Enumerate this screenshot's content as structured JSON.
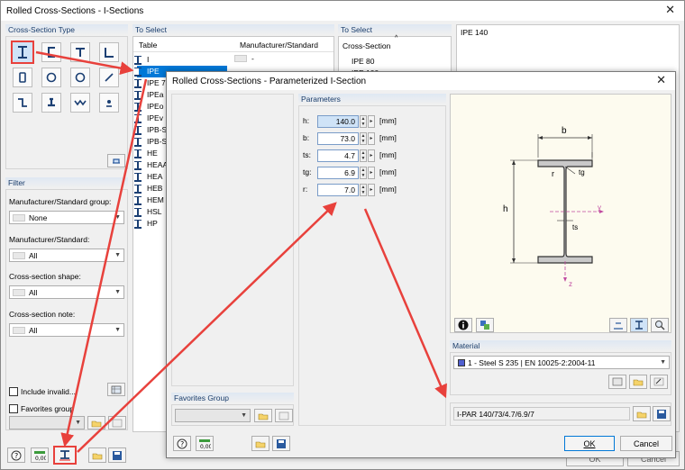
{
  "main_window": {
    "title": "Rolled Cross-Sections - I-Sections",
    "close_symbol": "✕",
    "cross_section_type_label": "Cross-Section Type",
    "filter_label": "Filter",
    "manufacturer_group_label": "Manufacturer/Standard group:",
    "manufacturer_group_value": "None",
    "manufacturer_label": "Manufacturer/Standard:",
    "manufacturer_value": "All",
    "shape_label": "Cross-section shape:",
    "shape_value": "All",
    "note_label": "Cross-section note:",
    "note_value": "All",
    "include_invalid_label": "Include invalid...",
    "favorites_label": "Favorites group",
    "to_select_left_label": "To Select",
    "to_select_right_label": "To Select",
    "table_col_header": "Table",
    "manufacturer_col_header": "Manufacturer/Standard",
    "tables": [
      "I",
      "IPE",
      "IPE 7",
      "IPEa",
      "IPEo",
      "IPEv",
      "IPB-S",
      "IPB-S",
      "HE",
      "HEAA",
      "HEA",
      "HEB",
      "HEM",
      "HSL",
      "HP"
    ],
    "first_row_manufacturer": "-",
    "cross_section_col_header": "Cross-Section",
    "cross_sections": [
      "IPE 80",
      "IPE 100"
    ],
    "preview_title": "IPE 140",
    "bottom_ok_ghost": "OK",
    "bottom_cancel_ghost": "Cancel"
  },
  "dialog": {
    "title": "Rolled Cross-Sections - Parameterized I-Section",
    "close_symbol": "✕",
    "parameters_label": "Parameters",
    "params": [
      {
        "name": "h:",
        "value": "140.0",
        "unit": "[mm]"
      },
      {
        "name": "b:",
        "value": "73.0",
        "unit": "[mm]"
      },
      {
        "name": "ts:",
        "value": "4.7",
        "unit": "[mm]"
      },
      {
        "name": "tg:",
        "value": "6.9",
        "unit": "[mm]"
      },
      {
        "name": "r:",
        "value": "7.0",
        "unit": "[mm]"
      }
    ],
    "favorites_group_label": "Favorites Group",
    "material_label": "Material",
    "material_value": "1 - Steel S 235 | EN 10025-2:2004-11",
    "material_color": "#4f5fd0",
    "name_value": "I-PAR 140/73/4.7/6.9/7",
    "ok_label": "OK",
    "cancel_label": "Cancel",
    "drawing": {
      "b_label": "b",
      "h_label": "h",
      "r_label": "r",
      "tg_label": "tg",
      "ts_label": "ts",
      "y_label": "y",
      "z_label": "z"
    }
  },
  "colors": {
    "accent_red": "#e8413c",
    "selection_blue": "#0078d7",
    "header_blue": "#1a3d6b"
  }
}
